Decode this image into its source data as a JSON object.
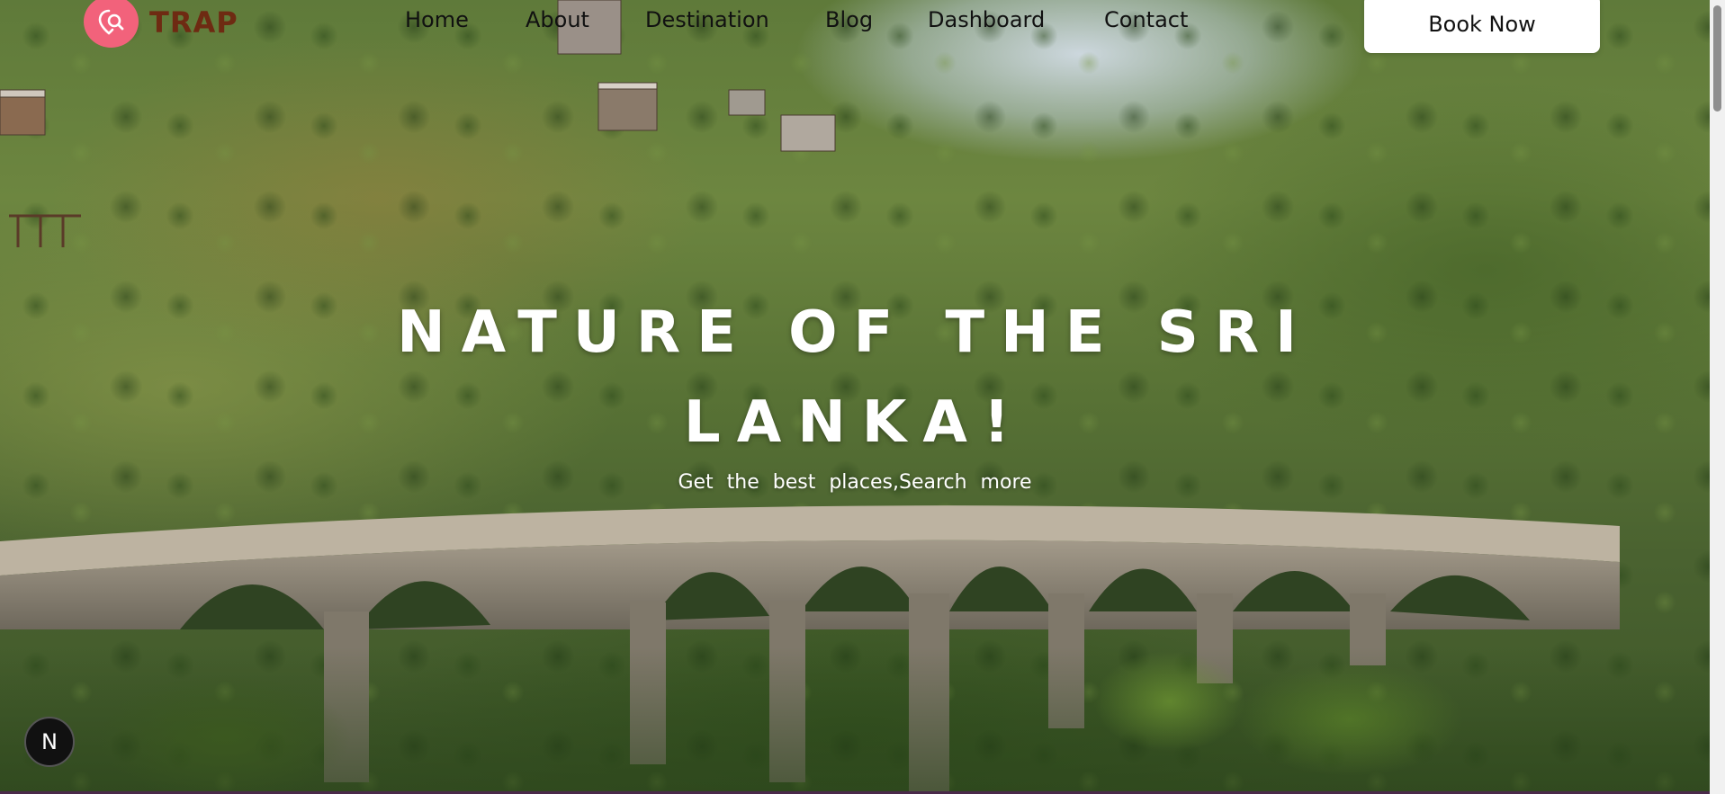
{
  "brand": {
    "name": "TRAP",
    "logo_icon": "location-search-icon",
    "logo_color": "#f2627b",
    "name_color": "#6e2a12"
  },
  "nav": {
    "links": [
      {
        "label": "Home"
      },
      {
        "label": "About"
      },
      {
        "label": "Destination"
      },
      {
        "label": "Blog"
      },
      {
        "label": "Dashboard"
      },
      {
        "label": "Contact"
      }
    ],
    "cta_label": "Book Now"
  },
  "hero": {
    "title": "NATURE OF THE SRI LANKA!",
    "subtitle": "Get the best places,Search more",
    "background": "Nine Arches Bridge amid forested hills"
  },
  "widgets": {
    "badge_letter": "N",
    "badge_icon": "nextjs-icon"
  }
}
